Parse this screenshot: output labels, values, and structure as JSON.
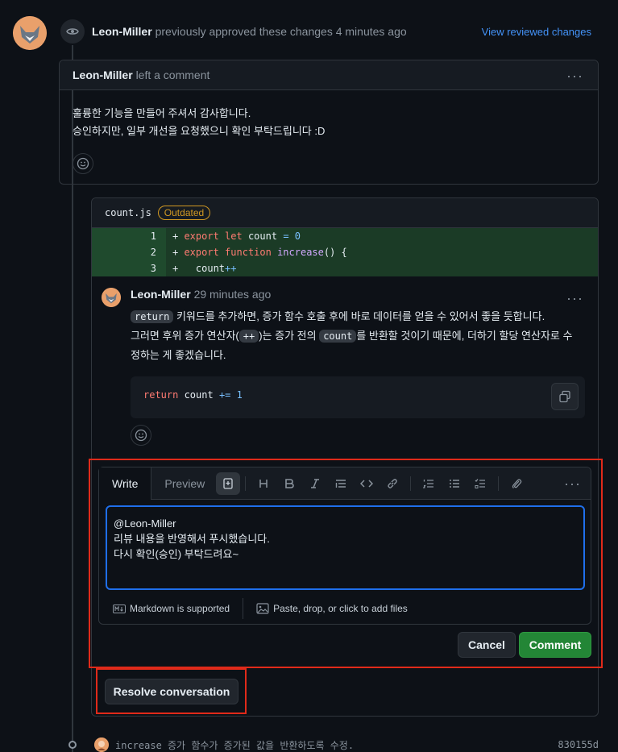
{
  "review": {
    "author": "Leon-Miller",
    "action": "previously approved these changes 4 minutes ago",
    "view_link": "View reviewed changes"
  },
  "comment": {
    "author": "Leon-Miller",
    "action": "left a comment",
    "lines": [
      "훌륭한 기능을 만들어 주셔서 감사합니다.",
      "승인하지만, 일부 개선을 요청했으니 확인 부탁드립니다 :D"
    ]
  },
  "thread": {
    "filename": "count.js",
    "badge": "Outdated",
    "diff": [
      {
        "ln": "1",
        "sign": "+ ",
        "parts": [
          [
            "kw",
            "export"
          ],
          [
            "t",
            " "
          ],
          [
            "kw",
            "let"
          ],
          [
            "t",
            " count "
          ],
          [
            "kw",
            "="
          ],
          [
            "t",
            " "
          ],
          [
            "num",
            "0"
          ]
        ]
      },
      {
        "ln": "2",
        "sign": "+ ",
        "parts": [
          [
            "kw",
            "export"
          ],
          [
            "t",
            " "
          ],
          [
            "kw",
            "function"
          ],
          [
            "t",
            " "
          ],
          [
            "fn",
            "increase"
          ],
          [
            "t",
            "() {"
          ]
        ]
      },
      {
        "ln": "3",
        "sign": "+ ",
        "parts": [
          [
            "t",
            "  count"
          ],
          [
            "num",
            "++"
          ]
        ]
      }
    ],
    "review_comment": {
      "author": "Leon-Miller",
      "time": "29 minutes ago",
      "p1_code": "return",
      "p1_text": " 키워드를 추가하면, 증가 함수 호출 후에 바로 데이터를 얻을 수 있어서 좋을 듯합니다.",
      "p2_a": "그러면 후위 증가 연산자(",
      "p2_code1": "++",
      "p2_b": ")는 증가 전의 ",
      "p2_code2": "count",
      "p2_c": "를 반환할 것이기 때문에, 더하기 할당 연산자로 수",
      "p2_d": "정하는 게 좋겠습니다.",
      "code_kw": "return",
      "code_mid": " count ",
      "code_op": "+=",
      "code_num": " 1"
    }
  },
  "editor": {
    "tab_write": "Write",
    "tab_preview": "Preview",
    "text": "@Leon-Miller\n리뷰 내용을 반영해서 푸시했습니다.\n다시 확인(승인) 부탁드려요~",
    "markdown_note": "Markdown is supported",
    "files_note": "Paste, drop, or click to add files",
    "cancel": "Cancel",
    "comment": "Comment"
  },
  "resolve": "Resolve conversation",
  "commit": {
    "message": "increase 증가 함수가 증가된 값을 반환하도록 수정.",
    "sha": "830155d"
  },
  "colors": {
    "accent": "#4493f8",
    "comment_button": "#238636",
    "highlight_box": "#e02a1a",
    "outdated": "#d29922"
  },
  "icons": [
    "eye-icon",
    "kebab-icon",
    "smiley-icon",
    "copy-icon",
    "heading-icon",
    "bold-icon",
    "italic-icon",
    "quote-icon",
    "code-icon",
    "link-icon",
    "ordered-list-icon",
    "unordered-list-icon",
    "task-list-icon",
    "paperclip-icon",
    "markdown-icon",
    "image-icon"
  ]
}
